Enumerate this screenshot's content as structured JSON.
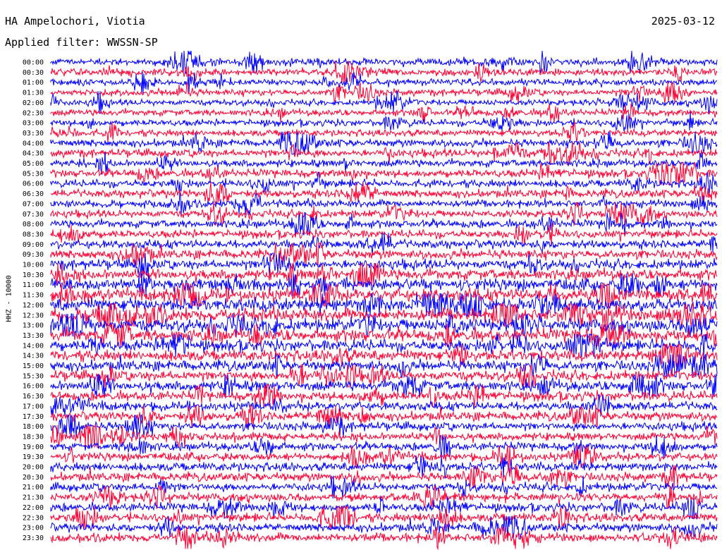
{
  "header": {
    "station": "HA Ampelochori, Viotia",
    "date": "2025-03-12",
    "filter": "Applied filter: WWSSN-SP"
  },
  "chart_data": {
    "type": "line",
    "title": "HA Ampelochori, Viotia",
    "ylabel": "HHZ - 10000",
    "colors": [
      "#0000ff",
      "#ff0033"
    ],
    "traces": [
      {
        "label": "00:00",
        "activity": 0.35
      },
      {
        "label": "00:30",
        "activity": 0.4
      },
      {
        "label": "01:00",
        "activity": 0.3
      },
      {
        "label": "01:30",
        "activity": 0.3
      },
      {
        "label": "02:00",
        "activity": 0.25
      },
      {
        "label": "02:30",
        "activity": 0.3
      },
      {
        "label": "03:00",
        "activity": 0.3
      },
      {
        "label": "03:30",
        "activity": 0.3
      },
      {
        "label": "04:00",
        "activity": 0.4
      },
      {
        "label": "04:30",
        "activity": 0.45
      },
      {
        "label": "05:00",
        "activity": 0.4
      },
      {
        "label": "05:30",
        "activity": 0.45
      },
      {
        "label": "06:00",
        "activity": 0.4
      },
      {
        "label": "06:30",
        "activity": 0.45
      },
      {
        "label": "07:00",
        "activity": 0.4
      },
      {
        "label": "07:30",
        "activity": 0.4
      },
      {
        "label": "08:00",
        "activity": 0.45
      },
      {
        "label": "08:30",
        "activity": 0.45
      },
      {
        "label": "09:00",
        "activity": 0.5
      },
      {
        "label": "09:30",
        "activity": 0.55
      },
      {
        "label": "10:00",
        "activity": 0.65
      },
      {
        "label": "10:30",
        "activity": 0.75
      },
      {
        "label": "11:00",
        "activity": 0.85
      },
      {
        "label": "11:30",
        "activity": 0.95
      },
      {
        "label": "12:00",
        "activity": 1.0
      },
      {
        "label": "12:30",
        "activity": 1.0
      },
      {
        "label": "13:00",
        "activity": 1.0
      },
      {
        "label": "13:30",
        "activity": 0.95
      },
      {
        "label": "14:00",
        "activity": 0.8
      },
      {
        "label": "14:30",
        "activity": 0.75
      },
      {
        "label": "15:00",
        "activity": 0.7
      },
      {
        "label": "15:30",
        "activity": 0.7
      },
      {
        "label": "16:00",
        "activity": 0.7
      },
      {
        "label": "16:30",
        "activity": 0.6
      },
      {
        "label": "17:00",
        "activity": 0.55
      },
      {
        "label": "17:30",
        "activity": 0.55
      },
      {
        "label": "18:00",
        "activity": 0.5
      },
      {
        "label": "18:30",
        "activity": 0.45
      },
      {
        "label": "19:00",
        "activity": 0.45
      },
      {
        "label": "19:30",
        "activity": 0.45
      },
      {
        "label": "20:00",
        "activity": 0.5
      },
      {
        "label": "20:30",
        "activity": 0.5
      },
      {
        "label": "21:00",
        "activity": 0.5
      },
      {
        "label": "21:30",
        "activity": 0.5
      },
      {
        "label": "22:00",
        "activity": 0.5
      },
      {
        "label": "22:30",
        "activity": 0.5
      },
      {
        "label": "23:00",
        "activity": 0.5
      },
      {
        "label": "23:30",
        "activity": 0.55
      }
    ]
  }
}
